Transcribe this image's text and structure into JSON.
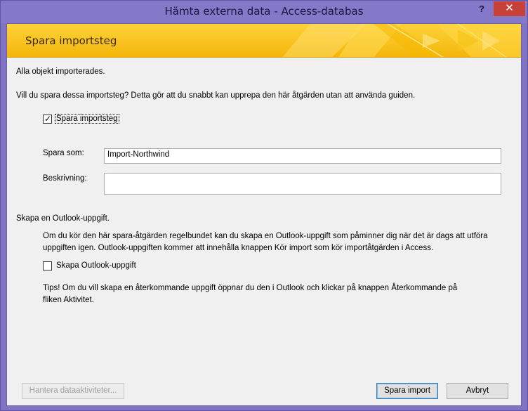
{
  "window": {
    "title": "Hämta externa data - Access-databas",
    "help_label": "?",
    "close_label": "✕"
  },
  "banner": {
    "title": "Spara importsteg"
  },
  "main": {
    "status_text": "Alla objekt importerades.",
    "question_text": "Vill du spara dessa importsteg? Detta gör att du snabbt kan upprepa den här åtgärden utan att använda guiden.",
    "save_steps_checkbox": {
      "label": "Spara importsteg",
      "checked": true
    },
    "save_as_label": "Spara som:",
    "save_as_value": "Import-Northwind",
    "description_label": "Beskrivning:",
    "description_value": "",
    "outlook_section_title": "Skapa en Outlook-uppgift.",
    "outlook_info_line1": "Om du kör den här spara-åtgärden regelbundet kan du skapa en Outlook-uppgift som påminner dig när det är dags att utföra",
    "outlook_info_line2": "uppgiften igen. Outlook-uppgiften kommer att innehålla knappen Kör import som kör importåtgärden i Access.",
    "outlook_checkbox": {
      "label": "Skapa Outlook-uppgift",
      "checked": false
    },
    "tip_line1": "Tips! Om du vill skapa en återkommande uppgift öppnar du den i Outlook och klickar på knappen Återkommande på",
    "tip_line2": "fliken Aktivitet."
  },
  "footer": {
    "manage_button": "Hantera dataaktiviteter...",
    "save_import_button": "Spara import",
    "cancel_button": "Avbryt"
  },
  "colors": {
    "titlebar": "#8478c8",
    "close_button": "#c7413a",
    "banner": "#f3b60a",
    "dialog_bg": "#f0f0f0"
  }
}
